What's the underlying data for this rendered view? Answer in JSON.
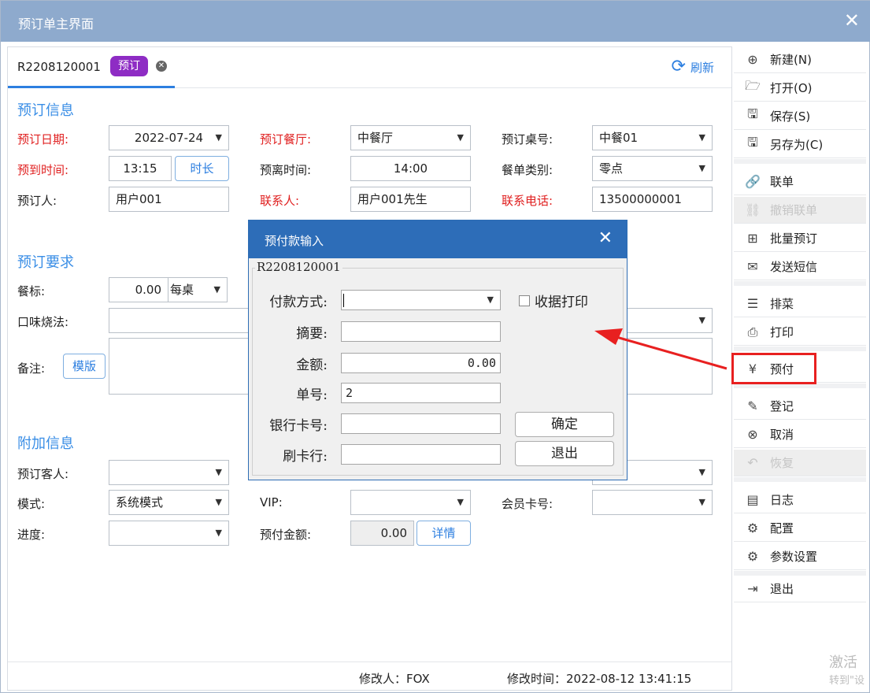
{
  "window": {
    "title": "预订单主界面",
    "close": "✕"
  },
  "tab": {
    "id": "R2208120001",
    "badge": "预订",
    "refresh": "刷新"
  },
  "sections": {
    "info": "预订信息",
    "requirements": "预订要求",
    "extra": "附加信息"
  },
  "info": {
    "date_label": "预订日期:",
    "date_value": "2022-07-24",
    "restaurant_label": "预订餐厅:",
    "restaurant_value": "中餐厅",
    "table_label": "预订桌号:",
    "table_value": "中餐01",
    "arrive_label": "预到时间:",
    "arrive_value": "13:15",
    "duration_button": "时长",
    "leave_label": "预离时间:",
    "leave_value": "14:00",
    "menu_type_label": "餐单类别:",
    "menu_type_value": "零点",
    "booker_label": "预订人:",
    "booker_value": "用户001",
    "contact_label": "联系人:",
    "contact_value": "用户001先生",
    "phone_label": "联系电话:",
    "phone_value": "13500000001"
  },
  "requirements": {
    "standard_label": "餐标:",
    "standard_value": "0.00",
    "standard_unit": "每桌",
    "taste_label": "口味烧法:",
    "remark_label": "备注:",
    "template_button": "模版"
  },
  "extra": {
    "guest_label": "预订客人:",
    "mode_label": "模式:",
    "mode_value": "系统模式",
    "vip_label": "VIP:",
    "member_label": "会员卡号:",
    "progress_label": "进度:",
    "prepay_label": "预付金额:",
    "prepay_value": "0.00",
    "detail_button": "详情"
  },
  "footer": {
    "modifier": "修改人：FOX",
    "modified_time": "修改时间：2022-08-12 13:41:15"
  },
  "sidebar": {
    "items": [
      {
        "icon": "⊕",
        "label": "新建(N)"
      },
      {
        "icon": "🗁",
        "label": "打开(O)"
      },
      {
        "icon": "🖫",
        "label": "保存(S)"
      },
      {
        "icon": "🖫",
        "label": "另存为(C)"
      },
      {
        "icon": "🔗",
        "label": "联单"
      },
      {
        "icon": "⛓",
        "label": "撤销联单"
      },
      {
        "icon": "⊞",
        "label": "批量预订"
      },
      {
        "icon": "✉",
        "label": "发送短信"
      },
      {
        "icon": "☰",
        "label": "排菜"
      },
      {
        "icon": "⎙",
        "label": "打印"
      },
      {
        "icon": "¥",
        "label": "预付"
      },
      {
        "icon": "✎",
        "label": "登记"
      },
      {
        "icon": "⊗",
        "label": "取消"
      },
      {
        "icon": "↶",
        "label": "恢复"
      },
      {
        "icon": "▤",
        "label": "日志"
      },
      {
        "icon": "⚙",
        "label": "配置"
      },
      {
        "icon": "⚙",
        "label": "参数设置"
      },
      {
        "icon": "⇥",
        "label": "退出"
      }
    ]
  },
  "watermark": {
    "line1": "激活",
    "line2": "转到\"设"
  },
  "dialog": {
    "title": "预付款输入",
    "close": "✕",
    "group_title": "R2208120001",
    "payment_label": "付款方式:",
    "print_receipt": "收据打印",
    "summary_label": "摘要:",
    "amount_label": "金额:",
    "amount_value": "0.00",
    "number_label": "单号:",
    "number_value": "2",
    "card_label": "银行卡号:",
    "bank_label": "刷卡行:",
    "confirm": "确定",
    "exit": "退出"
  },
  "colors": {
    "accent": "#2d7fe0",
    "titlebar": "#8eaacd",
    "dialog_titlebar": "#2d6db8",
    "required": "#e02020",
    "badge": "#8e2cc4",
    "annotation": "#e82020"
  }
}
